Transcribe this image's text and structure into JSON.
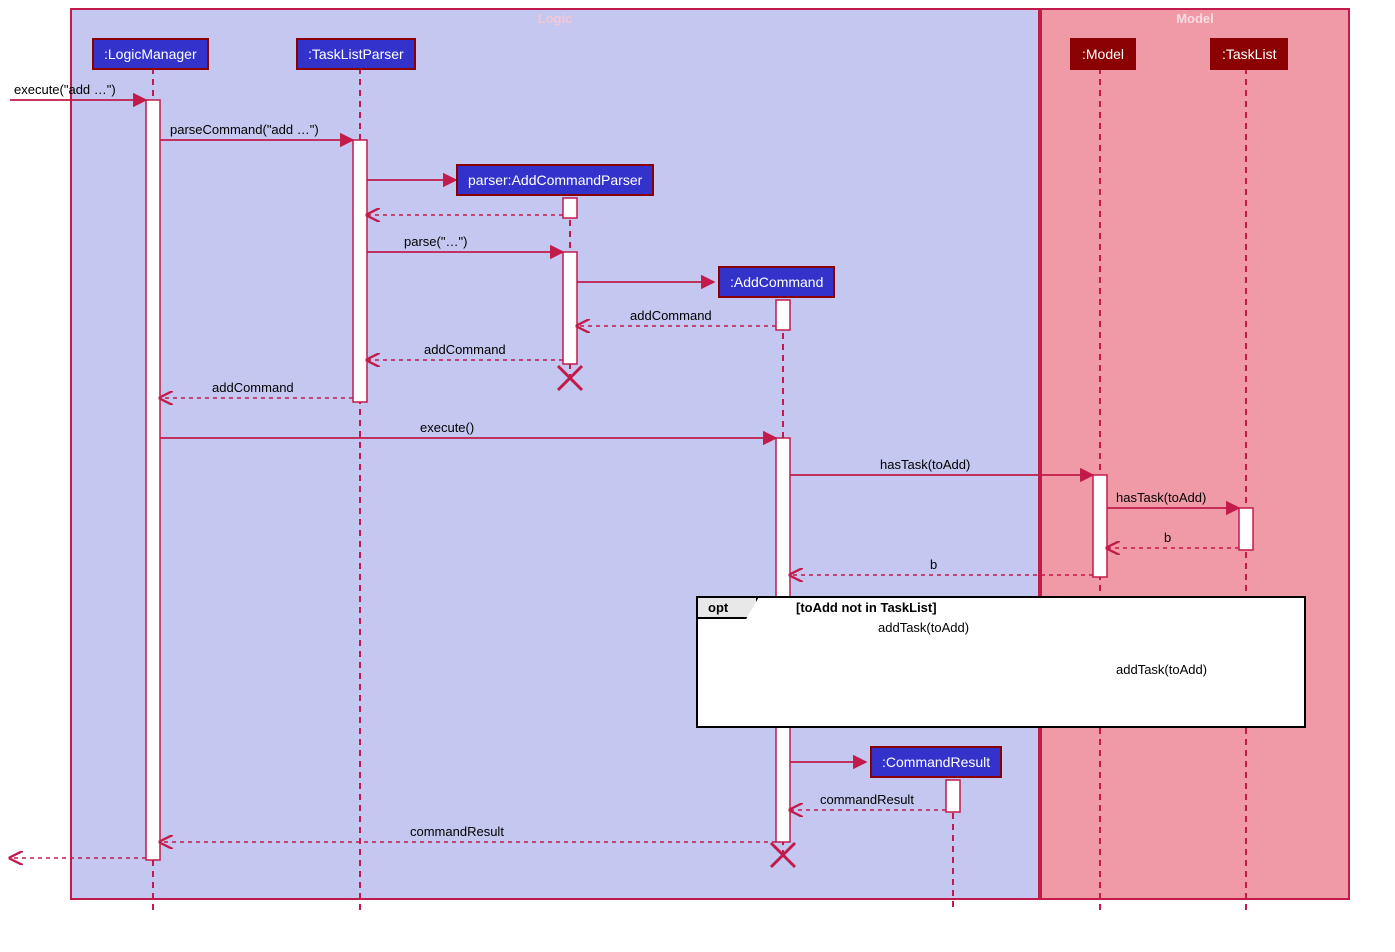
{
  "regions": {
    "logic": {
      "title": "Logic"
    },
    "model": {
      "title": "Model"
    }
  },
  "participants": {
    "logicManager": {
      "label": ":LogicManager"
    },
    "taskListParser": {
      "label": ":TaskListParser"
    },
    "addCommandParser": {
      "label": "parser:AddCommandParser"
    },
    "addCommand": {
      "label": ":AddCommand"
    },
    "commandResult": {
      "label": ":CommandResult"
    },
    "modelObj": {
      "label": ":Model"
    },
    "taskList": {
      "label": ":TaskList"
    }
  },
  "messages": {
    "m1": "execute(\"add …\")",
    "m2": "parseCommand(\"add …\")",
    "m3": "parse(\"…\")",
    "m4": "addCommand",
    "m5": "addCommand",
    "m6": "addCommand",
    "m7": "execute()",
    "m8": "hasTask(toAdd)",
    "m9": "hasTask(toAdd)",
    "m10": "b",
    "m11": "b",
    "m12": "addTask(toAdd)",
    "m13": "addTask(toAdd)",
    "m14": "commandResult",
    "m15": "commandResult"
  },
  "opt": {
    "label": "opt",
    "guard": "[toAdd not in TaskList]"
  },
  "chart_data": {
    "type": "uml_sequence_diagram",
    "regions": [
      {
        "name": "Logic",
        "participants": [
          ":LogicManager",
          ":TaskListParser",
          "parser:AddCommandParser",
          ":AddCommand",
          ":CommandResult"
        ]
      },
      {
        "name": "Model",
        "participants": [
          ":Model",
          ":TaskList"
        ]
      }
    ],
    "participants": [
      ":LogicManager",
      ":TaskListParser",
      "parser:AddCommandParser",
      ":AddCommand",
      ":CommandResult",
      ":Model",
      ":TaskList"
    ],
    "interactions": [
      {
        "from": "external",
        "to": ":LogicManager",
        "label": "execute(\"add …\")",
        "type": "call"
      },
      {
        "from": ":LogicManager",
        "to": ":TaskListParser",
        "label": "parseCommand(\"add …\")",
        "type": "call"
      },
      {
        "from": ":TaskListParser",
        "to": "parser:AddCommandParser",
        "label": "",
        "type": "create"
      },
      {
        "from": "parser:AddCommandParser",
        "to": ":TaskListParser",
        "label": "",
        "type": "return"
      },
      {
        "from": ":TaskListParser",
        "to": "parser:AddCommandParser",
        "label": "parse(\"…\")",
        "type": "call"
      },
      {
        "from": "parser:AddCommandParser",
        "to": ":AddCommand",
        "label": "",
        "type": "create"
      },
      {
        "from": ":AddCommand",
        "to": "parser:AddCommandParser",
        "label": "addCommand",
        "type": "return"
      },
      {
        "from": "parser:AddCommandParser",
        "to": ":TaskListParser",
        "label": "addCommand",
        "type": "return"
      },
      {
        "note": "parser:AddCommandParser destroyed"
      },
      {
        "from": ":TaskListParser",
        "to": ":LogicManager",
        "label": "addCommand",
        "type": "return"
      },
      {
        "from": ":LogicManager",
        "to": ":AddCommand",
        "label": "execute()",
        "type": "call"
      },
      {
        "from": ":AddCommand",
        "to": ":Model",
        "label": "hasTask(toAdd)",
        "type": "call"
      },
      {
        "from": ":Model",
        "to": ":TaskList",
        "label": "hasTask(toAdd)",
        "type": "call"
      },
      {
        "from": ":TaskList",
        "to": ":Model",
        "label": "b",
        "type": "return"
      },
      {
        "from": ":Model",
        "to": ":AddCommand",
        "label": "b",
        "type": "return"
      },
      {
        "fragment": "opt",
        "guard": "toAdd not in TaskList",
        "interactions": [
          {
            "from": ":AddCommand",
            "to": ":Model",
            "label": "addTask(toAdd)",
            "type": "call"
          },
          {
            "from": ":Model",
            "to": ":TaskList",
            "label": "addTask(toAdd)",
            "type": "call"
          },
          {
            "from": ":TaskList",
            "to": ":Model",
            "label": "",
            "type": "return"
          },
          {
            "from": ":Model",
            "to": ":AddCommand",
            "label": "",
            "type": "return"
          }
        ]
      },
      {
        "from": ":AddCommand",
        "to": ":CommandResult",
        "label": "",
        "type": "create"
      },
      {
        "from": ":CommandResult",
        "to": ":AddCommand",
        "label": "commandResult",
        "type": "return"
      },
      {
        "note": ":AddCommand destroyed"
      },
      {
        "from": ":AddCommand",
        "to": ":LogicManager",
        "label": "commandResult",
        "type": "return"
      },
      {
        "from": ":LogicManager",
        "to": "external",
        "label": "",
        "type": "return"
      }
    ]
  }
}
